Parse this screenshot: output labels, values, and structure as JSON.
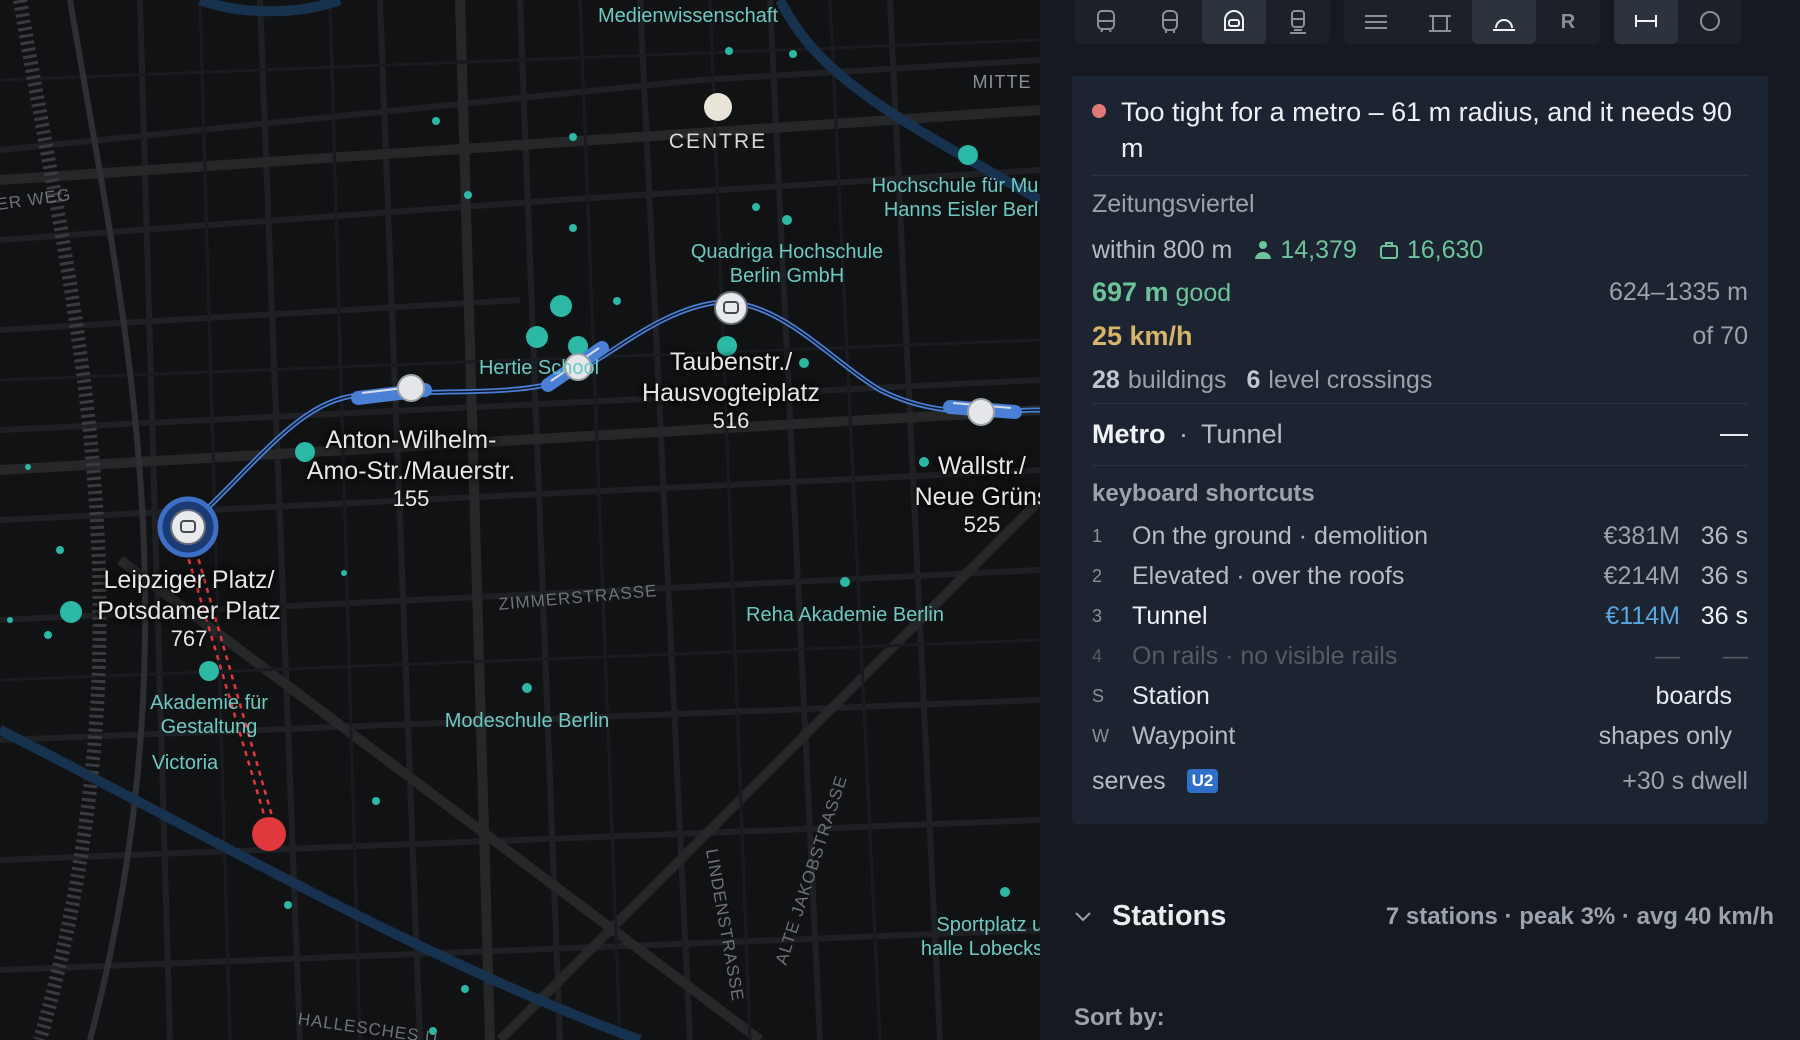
{
  "map": {
    "labels": {
      "medienwissenschaft": "Medienwissenschaft",
      "mitte": "MITTE",
      "centre": "CENTRE",
      "er_weg": "ER WEG",
      "hochschule_musik": "Hochschule für Mu\nHanns Eisler Berl",
      "quadriga": "Quadriga Hochschule\nBerlin GmbH",
      "hertie": "Hertie School",
      "zimmerstrasse": "ZIMMERSTRASSE",
      "reha": "Reha Akademie Berlin",
      "modeschule": "Modeschule Berlin",
      "akademie": "Akademie für\nGestaltung",
      "victoria": "Victoria",
      "lindenstrasse": "LINDENSTRASSE",
      "alte_jakob": "ALTE JAKOBSTRASSE",
      "sportplatz": "Sportplatz u\nhalle Lobecks",
      "hallesches": "HALLESCHES U"
    },
    "stations": [
      {
        "name": "Leipziger Platz/\nPotsdamer Platz",
        "count": "767"
      },
      {
        "name": "Anton-Wilhelm-\nAmo-Str./Mauerstr.",
        "count": "155"
      },
      {
        "name": "Taubenstr./\nHausvogteiplatz",
        "count": "516"
      },
      {
        "name": "Wallstr./\nNeue Grüns",
        "count": "525"
      }
    ],
    "line_color": "#3f6fc4",
    "poi_color": "#2bb8a5",
    "warning_color": "#e0383c"
  },
  "toolbar": {
    "groups": [
      [
        {
          "icon": "tram-icon",
          "active": false
        },
        {
          "icon": "bus-icon",
          "active": false
        },
        {
          "icon": "metro-icon",
          "active": true
        },
        {
          "icon": "train-icon",
          "active": false
        }
      ],
      [
        {
          "icon": "ground-icon",
          "active": false
        },
        {
          "icon": "elevated-icon",
          "active": false
        },
        {
          "icon": "tunnel-icon",
          "active": true
        },
        {
          "icon": "r-icon",
          "label": "R",
          "active": false
        }
      ],
      [
        {
          "icon": "segment-icon",
          "active": true
        },
        {
          "icon": "circle-icon",
          "active": false
        }
      ]
    ]
  },
  "card": {
    "warning": "Too tight for a metro – 61 m radius, and it needs 90 m",
    "zone": "Zeitungsviertel",
    "within_label": "within 800 m",
    "residents": "14,379",
    "jobs": "16,630",
    "spacing": "697 m",
    "spacing_rating": "good",
    "spacing_range": "624–1335 m",
    "speed": "25 km/h",
    "speed_max": "of 70",
    "buildings_count": "28",
    "buildings_label": "buildings",
    "crossings_count": "6",
    "crossings_label": "level crossings",
    "mode": "Metro",
    "mode_sep": "·",
    "mode_type": "Tunnel",
    "shortcuts_heading": "keyboard shortcuts",
    "options": [
      {
        "key": "1",
        "name": "On the ground · demolition",
        "cost": "€381M",
        "time": "36 s",
        "state": "normal"
      },
      {
        "key": "2",
        "name": "Elevated · over the roofs",
        "cost": "€214M",
        "time": "36 s",
        "state": "normal"
      },
      {
        "key": "3",
        "name": "Tunnel",
        "cost": "€114M",
        "time": "36 s",
        "state": "selected"
      },
      {
        "key": "4",
        "name": "On rails · no visible rails",
        "cost": "—",
        "time": "—",
        "state": "disabled"
      }
    ],
    "station_key": "S",
    "station_label": "Station",
    "station_note": "boards",
    "waypoint_key": "W",
    "waypoint_label": "Waypoint",
    "waypoint_note": "shapes only",
    "serves_label": "serves",
    "serves_badge": "U2",
    "dwell": "+30 s dwell"
  },
  "stations_section": {
    "title": "Stations",
    "summary": "7 stations · peak 3% · avg 40 km/h"
  },
  "sort_label": "Sort by:"
}
